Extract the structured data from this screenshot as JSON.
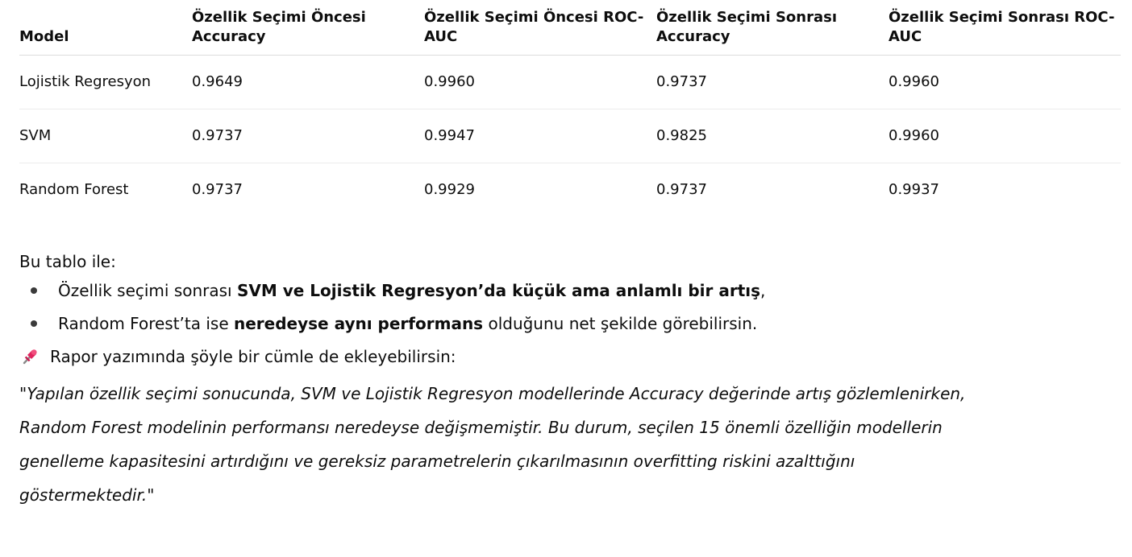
{
  "table": {
    "headers": [
      "Model",
      "Özellik Seçimi Öncesi Accuracy",
      "Özellik Seçimi Öncesi ROC-AUC",
      "Özellik Seçimi Sonrası Accuracy",
      "Özellik Seçimi Sonrası ROC-AUC"
    ],
    "rows": [
      [
        "Lojistik Regresyon",
        "0.9649",
        "0.9960",
        "0.9737",
        "0.9960"
      ],
      [
        "SVM",
        "0.9737",
        "0.9947",
        "0.9825",
        "0.9960"
      ],
      [
        "Random Forest",
        "0.9737",
        "0.9929",
        "0.9737",
        "0.9937"
      ]
    ]
  },
  "intro": "Bu tablo ile:",
  "bullets": [
    {
      "pre": "Özellik seçimi sonrası ",
      "bold": "SVM ve Lojistik Regresyon’da küçük ama anlamlı bir artış",
      "post": ","
    },
    {
      "pre": "Random Forest’ta ise ",
      "bold": "neredeyse aynı performans",
      "post": " olduğunu net şekilde görebilirsin."
    }
  ],
  "note": {
    "icon": "pushpin-icon",
    "text": "Rapor yazımında şöyle bir cümle de ekleyebilirsin:"
  },
  "quote": "\"Yapılan özellik seçimi sonucunda, SVM ve Lojistik Regresyon modellerinde Accuracy değerinde artış gözlemlenirken, Random Forest modelinin performansı neredeyse değişmemiştir. Bu durum, seçilen 15 önemli özelliğin modellerin genelleme kapasitesini artırdığını ve gereksiz parametrelerin çıkarılmasının overfitting riskini azalttığını göstermektedir.\"",
  "colors": {
    "text": "#0d0d0d",
    "divider": "#ececec",
    "pin": "#e0245e"
  }
}
